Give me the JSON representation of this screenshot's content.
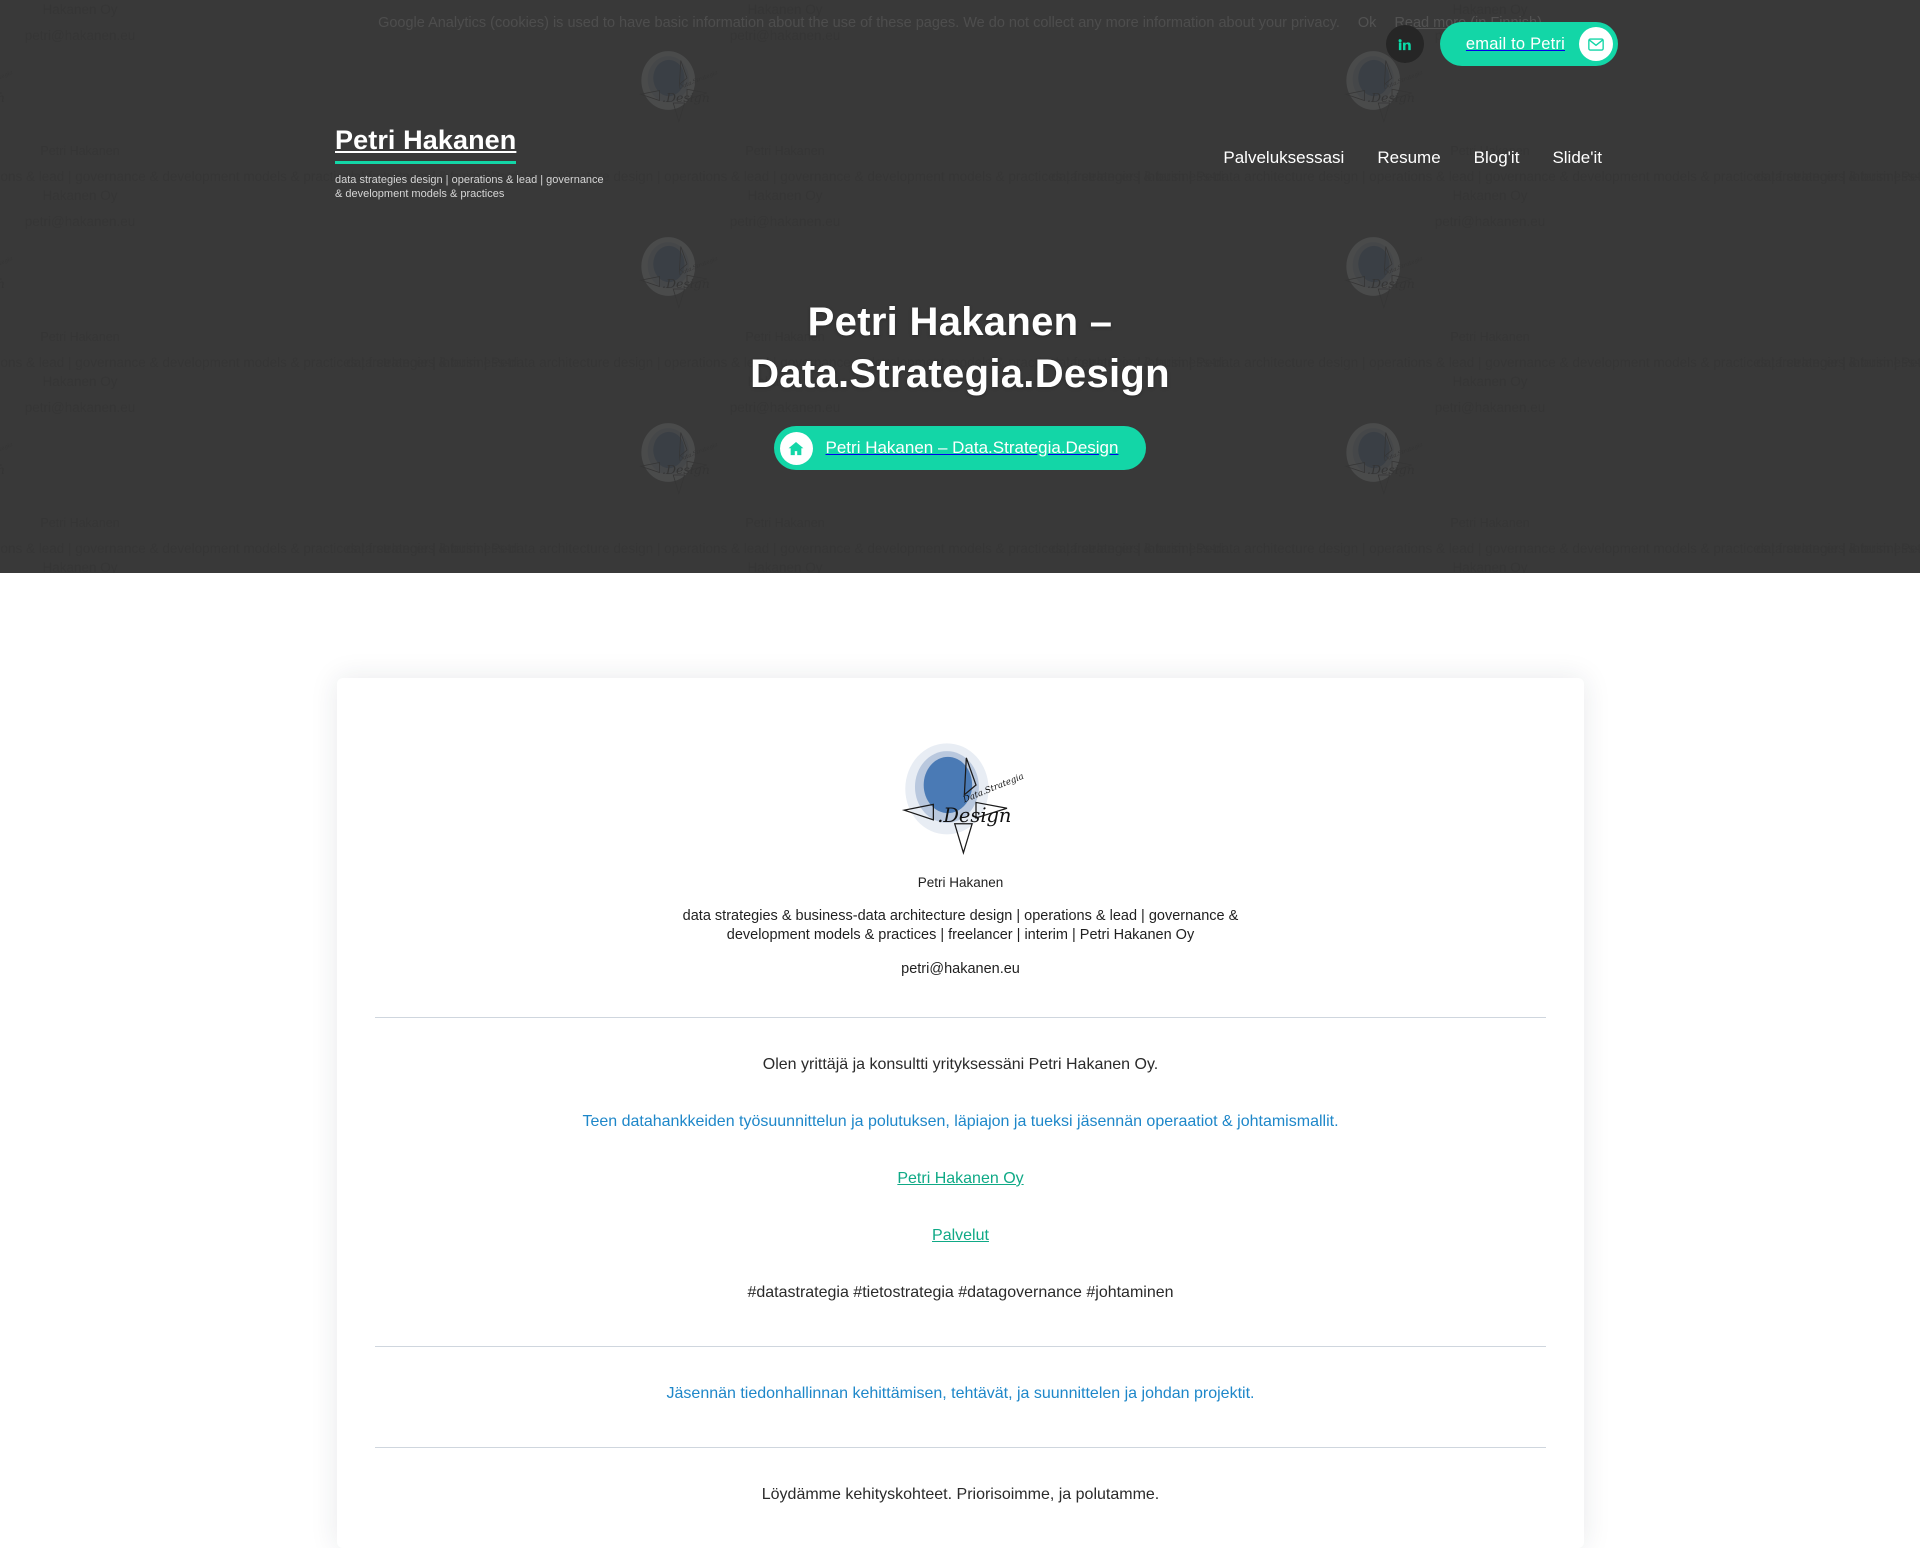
{
  "colors": {
    "accent_teal": "#13d6a7",
    "link_teal": "#0fa986",
    "link_blue": "#1e87c9",
    "hero_overlay": "#383838",
    "card_bg": "#ffffff",
    "social_bg": "#262626"
  },
  "cookie_banner": {
    "message": "Google Analytics (cookies) is used to have basic information about the use of these pages. We do not collect any more information about your privacy.",
    "ok_label": "Ok",
    "read_more_label": "Read more (in Finnish)"
  },
  "topbar": {
    "linkedin_icon": "linkedin-icon",
    "email_cta_label": "email to Petri",
    "email_icon": "envelope-icon"
  },
  "header": {
    "brand_title": "Petri Hakanen",
    "brand_tagline": "data strategies design | operations & lead | governance & development models & practices",
    "nav": [
      {
        "label": "Palveluksessasi"
      },
      {
        "label": "Resume"
      },
      {
        "label": "Blog'it"
      },
      {
        "label": "Slide'it"
      }
    ]
  },
  "hero": {
    "title_line1": "Petri Hakanen –",
    "title_line2": "Data.Strategia.Design",
    "button_label": "Petri Hakanen – Data.Strategia.Design",
    "button_icon": "home-icon"
  },
  "background_tile": {
    "name": "Petri Hakanen",
    "description": "data strategies & business-data architecture design | operations & lead | governance & development models & practices | freelancer | interim | Petri Hakanen Oy",
    "email": "petri@hakanen.eu",
    "logo_word_design": ".Design",
    "logo_word_strategia": "Data.Strategia"
  },
  "card": {
    "logo_word_design": ".Design",
    "logo_word_strategia": "Data.Strategia",
    "name": "Petri Hakanen",
    "description_line1": "data strategies & business-data architecture design | operations & lead | governance &",
    "description_line2": "development models & practices | freelancer | interim | Petri Hakanen Oy",
    "email": "petri@hakanen.eu",
    "paragraphs": [
      {
        "text": "Olen yrittäjä ja konsultti yrityksessäni Petri Hakanen Oy.",
        "style": "dark"
      },
      {
        "text": "Teen datahankkeiden työsuunnittelun ja polutuksen, läpiajon ja tueksi jäsennän operaatiot & johtamismallit.",
        "style": "blue"
      }
    ],
    "link_company": "Petri Hakanen Oy",
    "link_services": "Palvelut",
    "hashtags": "#datastrategia #tietostrategia #datagovernance #johtaminen",
    "paragraph_blue_2": "Jäsennän tiedonhallinnan kehittämisen, tehtävät, ja suunnittelen ja johdan projektit.",
    "paragraph_dark_2": "Löydämme kehityskohteet. Priorisoimme, ja polutamme."
  }
}
